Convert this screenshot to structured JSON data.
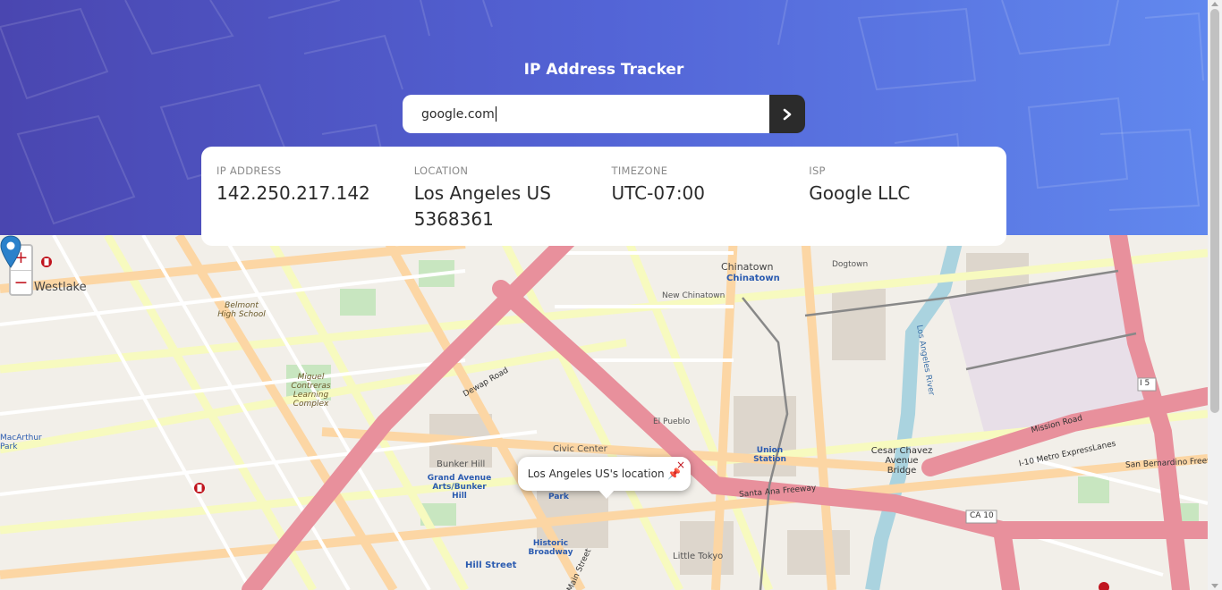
{
  "header": {
    "title": "IP Address Tracker"
  },
  "search": {
    "value": "google.com",
    "button_icon": "chevron-right-icon"
  },
  "info": {
    "ip": {
      "label": "IP ADDRESS",
      "value": "142.250.217.142"
    },
    "location": {
      "label": "LOCATION",
      "value_line1": "Los Angeles US",
      "value_line2": "5368361"
    },
    "timezone": {
      "label": "TIMEZONE",
      "value": "UTC-07:00"
    },
    "isp": {
      "label": "ISP",
      "value": "Google LLC"
    }
  },
  "map": {
    "zoom_in": "+",
    "zoom_out": "−",
    "popup": {
      "text": "Los Angeles US's location 📌",
      "close": "×"
    },
    "labels": {
      "westlake": "Westlake",
      "chinatown": "Chinatown",
      "chinatown_station": "Chinatown",
      "new_chinatown": "New Chinatown",
      "dogtown": "Dogtown",
      "belmont": "Belmont High School",
      "miguel": "Miguel Contreras Learning Complex",
      "el_pueblo": "El Pueblo",
      "civic_center": "Civic Center",
      "bunker_hill": "Bunker Hill",
      "grand_avenue": "Grand Avenue Arts/Bunker Hill",
      "park": "Park",
      "historic_broadway": "Historic Broadway",
      "hill_street": "Hill Street",
      "little_tokyo": "Little Tokyo",
      "cesar_chavez": "Cesar Chavez Avenue Bridge",
      "union_station": "Union Station",
      "santa_ana_freeway": "Santa Ana Freeway",
      "mission_road": "Mission Road",
      "metro_expresslanes": "I-10 Metro ExpressLanes",
      "san_bernardino": "San Bernardino Freeway",
      "la_river": "Los Angeles River",
      "dewap_road": "Dewap Road",
      "main_street": "Main Street",
      "arthur_park": "MacArthur Park",
      "ca10": "CA 10",
      "i5": "I 5"
    }
  },
  "colors": {
    "accent": "#5364d6",
    "dark": "#2b2b2b",
    "motorway": "#e8909c",
    "primary_road": "#fcd6a4",
    "secondary_road": "#f7fabf"
  }
}
